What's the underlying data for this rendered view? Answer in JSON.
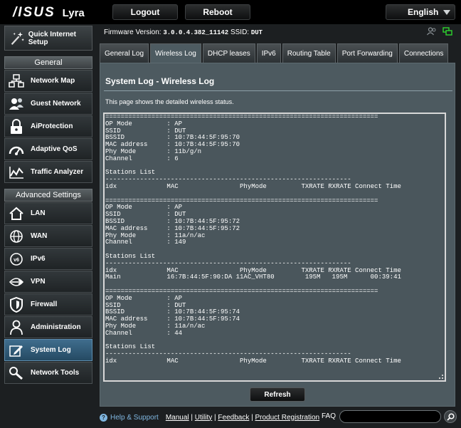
{
  "brand": {
    "logo": "/ISUS",
    "model": "Lyra"
  },
  "topbar": {
    "logout": "Logout",
    "reboot": "Reboot",
    "language": "English"
  },
  "firmware": {
    "label": "Firmware Version:",
    "version": "3.0.0.4.382_11142",
    "ssid_label": "SSID:",
    "ssid": "DUT"
  },
  "sidebar": {
    "qis": "Quick Internet Setup",
    "general_header": "General",
    "general": [
      {
        "label": "Network Map",
        "icon": "network-map-icon"
      },
      {
        "label": "Guest Network",
        "icon": "guest-network-icon"
      },
      {
        "label": "AiProtection",
        "icon": "lock-icon"
      },
      {
        "label": "Adaptive QoS",
        "icon": "speedometer-icon"
      },
      {
        "label": "Traffic Analyzer",
        "icon": "traffic-chart-icon"
      }
    ],
    "advanced_header": "Advanced Settings",
    "advanced": [
      {
        "label": "LAN",
        "icon": "home-icon"
      },
      {
        "label": "WAN",
        "icon": "globe-icon"
      },
      {
        "label": "IPv6",
        "icon": "ipv6-globe-icon"
      },
      {
        "label": "VPN",
        "icon": "vpn-icon"
      },
      {
        "label": "Firewall",
        "icon": "shield-icon"
      },
      {
        "label": "Administration",
        "icon": "admin-user-icon"
      },
      {
        "label": "System Log",
        "icon": "pencil-icon"
      },
      {
        "label": "Network Tools",
        "icon": "wrench-icon"
      }
    ]
  },
  "tabs": [
    "General Log",
    "Wireless Log",
    "DHCP leases",
    "IPv6",
    "Routing Table",
    "Port Forwarding",
    "Connections"
  ],
  "active_tab": "Wireless Log",
  "panel": {
    "title": "System Log - Wireless Log",
    "description": "This page shows the detailed wireless status.",
    "refresh": "Refresh"
  },
  "log_text": "=======================================================================\nOP Mode         : AP\nSSID            : DUT\nBSSID           : 10:7B:44:5F:95:70\nMAC address     : 10:7B:44:5F:95:70\nPhy Mode        : 11b/g/n\nChannel         : 6\n\nStations List\n----------------------------------------------------------------\nidx             MAC                PhyMode         TXRATE RXRATE Connect Time\n\n=======================================================================\nOP Mode         : AP\nSSID            : DUT\nBSSID           : 10:7B:44:5F:95:72\nMAC address     : 10:7B:44:5F:95:72\nPhy Mode        : 11a/n/ac\nChannel         : 149\n\nStations List\n----------------------------------------------------------------\nidx             MAC                PhyMode         TXRATE RXRATE Connect Time\nMain            16:7B:44:5F:90:DA 11AC_VHT80        195M   195M      00:39:41\n\n=======================================================================\nOP Mode         : AP\nSSID            : DUT\nBSSID           : 10:7B:44:5F:95:74\nMAC address     : 10:7B:44:5F:95:74\nPhy Mode        : 11a/n/ac\nChannel         : 44\n\nStations List\n----------------------------------------------------------------\nidx             MAC                PhyMode         TXRATE RXRATE Connect Time",
  "footer": {
    "help": "Help & Support",
    "links": [
      "Manual",
      "Utility",
      "Feedback",
      "Product Registration"
    ],
    "faq": "FAQ",
    "faq_placeholder": ""
  },
  "colors": {
    "accent": "#7fb6e0",
    "panel": "#4d5a60",
    "active_menu": "#3f6d8d"
  }
}
